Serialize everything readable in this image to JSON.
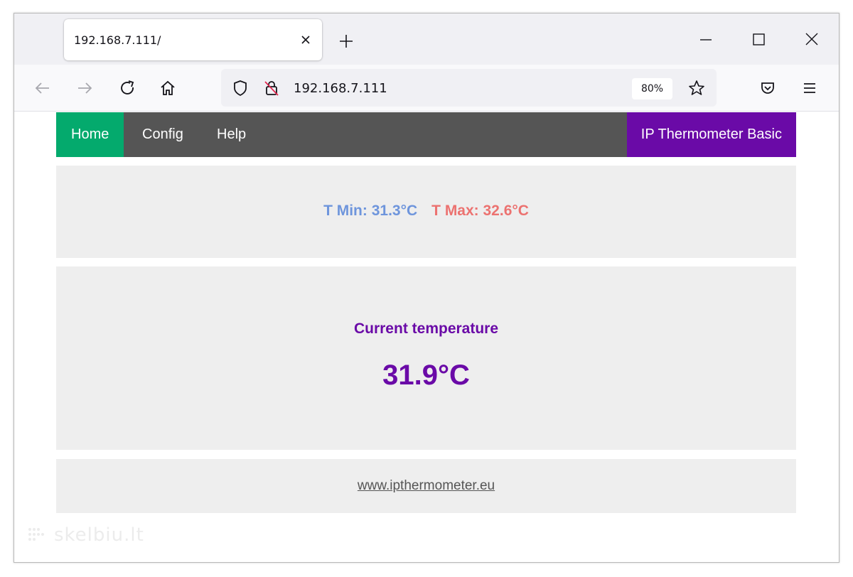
{
  "browser": {
    "tab_title": "192.168.7.111/",
    "url": "192.168.7.111",
    "zoom": "80%"
  },
  "site": {
    "nav": {
      "home": "Home",
      "config": "Config",
      "help": "Help",
      "brand": "IP Thermometer Basic"
    },
    "minmax": {
      "min": "T Min: 31.3°C",
      "max": "T Max: 32.6°C",
      "min_color": "#6e95dc",
      "max_color": "#ec7270"
    },
    "current": {
      "label": "Current temperature",
      "value": "31.9°C"
    },
    "footer": {
      "link": "www.ipthermometer.eu"
    },
    "colors": {
      "nav_bg": "#555555",
      "active": "#04aa6d",
      "brand": "#6a0aa7"
    }
  },
  "watermark": "skelbiu.lt"
}
